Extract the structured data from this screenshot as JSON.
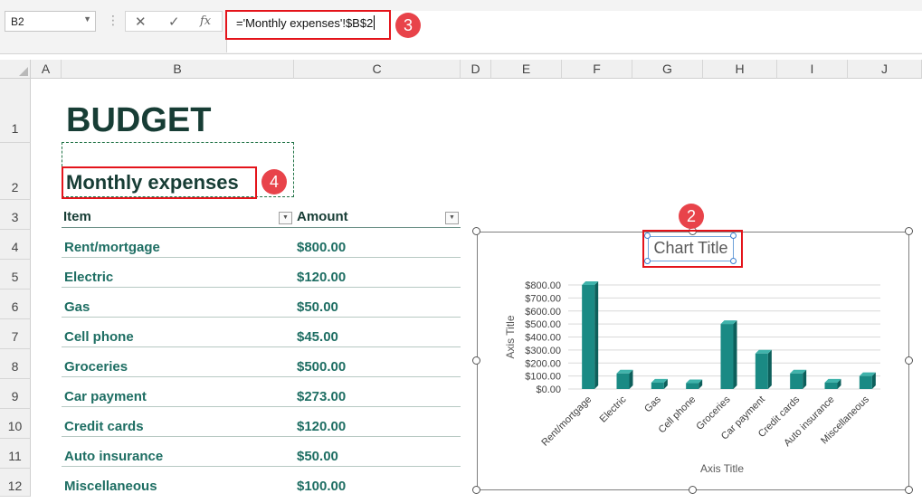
{
  "formula_bar": {
    "name_box": "B2",
    "cancel_glyph": "✕",
    "enter_glyph": "✓",
    "fx_glyph": "fx",
    "formula": "='Monthly expenses'!$B$2"
  },
  "columns": [
    "A",
    "B",
    "C",
    "D",
    "E",
    "F",
    "G",
    "H",
    "I",
    "J"
  ],
  "rows": [
    "1",
    "2",
    "3",
    "4",
    "5",
    "6",
    "7",
    "8",
    "9",
    "10",
    "11",
    "12"
  ],
  "sheet": {
    "title": "BUDGET",
    "subtitle": "Monthly expenses",
    "headers": {
      "item": "Item",
      "amount": "Amount"
    },
    "expenses": [
      {
        "item": "Rent/mortgage",
        "amount": "$800.00"
      },
      {
        "item": "Electric",
        "amount": "$120.00"
      },
      {
        "item": "Gas",
        "amount": "$50.00"
      },
      {
        "item": "Cell phone",
        "amount": "$45.00"
      },
      {
        "item": "Groceries",
        "amount": "$500.00"
      },
      {
        "item": "Car payment",
        "amount": "$273.00"
      },
      {
        "item": "Credit cards",
        "amount": "$120.00"
      },
      {
        "item": "Auto insurance",
        "amount": "$50.00"
      },
      {
        "item": "Miscellaneous",
        "amount": "$100.00"
      }
    ]
  },
  "annotations": {
    "b2": "2",
    "b3": "3",
    "b4": "4"
  },
  "colors": {
    "accent": "#e4141b",
    "bar": "#1a8a84",
    "title_text": "#173d35",
    "cell_text": "#1e6e63"
  },
  "chart_data": {
    "type": "bar",
    "title": "Chart Title",
    "xlabel": "Axis Title",
    "ylabel": "Axis Title",
    "categories": [
      "Rent/mortgage",
      "Electric",
      "Gas",
      "Cell phone",
      "Groceries",
      "Car payment",
      "Credit cards",
      "Auto insurance",
      "Miscellaneous"
    ],
    "values": [
      800,
      120,
      50,
      45,
      500,
      273,
      120,
      50,
      100
    ],
    "ylim": [
      0,
      800
    ],
    "yticks": [
      "$0.00",
      "$100.00",
      "$200.00",
      "$300.00",
      "$400.00",
      "$500.00",
      "$600.00",
      "$700.00",
      "$800.00"
    ],
    "grid": true,
    "legend": "none"
  }
}
